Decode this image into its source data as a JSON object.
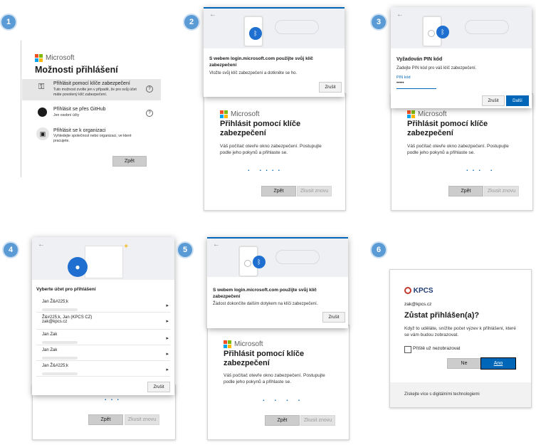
{
  "badges": [
    "1",
    "2",
    "3",
    "4",
    "5",
    "6"
  ],
  "brand": "Microsoft",
  "colors": {
    "accent": "#0067b8",
    "badge": "#5b9bd5"
  },
  "p1": {
    "title": "Možnosti přihlášení",
    "options": [
      {
        "title": "Přihlásit pomocí klíče zabezpečení",
        "desc": "Tuto možnost zvolte jen v případě, že pro svůj účet máte povolený klíč zabezpečení.",
        "icon": "security-key-icon",
        "help": "?"
      },
      {
        "title": "Přihlásit se přes GitHub",
        "desc": "Jen osobní účty",
        "icon": "github-icon",
        "help": "?"
      },
      {
        "title": "Přihlásit se k organizaci",
        "desc": "Vyhledejte společnost nebo organizaci, ve které pracujete.",
        "icon": "organization-badge-icon"
      }
    ],
    "back": "Zpět"
  },
  "p2": {
    "dialog_title": "S webem login.microsoft.com použijte svůj klíč zabezpečení",
    "dialog_text": "Vložte svůj klíč zabezpečení a dotkněte se ho.",
    "cancel": "Zrušit",
    "card_title": "Přihlásit pomocí klíče zabezpečení",
    "card_text": "Váš počítač otevře okno zabezpečení. Postupujte podle jeho pokynů a přihlaste se.",
    "back": "Zpět",
    "retry": "Zkusit znovu"
  },
  "p3": {
    "dialog_title": "Vyžadován PIN kód",
    "dialog_text": "Zadejte PIN kód pro váš klíč zabezpečení.",
    "pin_label": "PIN kód",
    "pin_value": "•••••",
    "cancel": "Zrušit",
    "next": "Další",
    "card_title": "Přihlásit pomocí klíče zabezpečení",
    "card_text": "Váš počítač otevře okno zabezpečení. Postupujte podle jeho pokynů a přihlaste se.",
    "back": "Zpět",
    "retry": "Zkusit znovu"
  },
  "p4": {
    "heading": "Vyberte účet pro přihlášení",
    "accounts": [
      {
        "name": "Jan Ž&#225;k",
        "sub": ""
      },
      {
        "name": "Ž&#225;k, Jan (KPCS CZ)",
        "sub": "zak@kpcs.cz"
      },
      {
        "name": "Jan Zak",
        "sub": ""
      },
      {
        "name": "Jan Zak",
        "sub": ""
      },
      {
        "name": "Jan Ž&#225;k",
        "sub": ""
      }
    ],
    "cancel": "Zrušit",
    "back": "Zpět",
    "retry": "Zkusit znovu"
  },
  "p5": {
    "dialog_title": "S webem login.microsoft.com použijte svůj klíč zabezpečení",
    "dialog_text": "Žádost dokončíte dalším dotykem na klíči zabezpečení.",
    "cancel": "Zrušit",
    "card_title": "Přihlásit pomocí klíče zabezpečení",
    "card_text": "Váš počítač otevře okno zabezpečení. Postupujte podle jeho pokynů a přihlaste se.",
    "back": "Zpět",
    "retry": "Zkusit znovu"
  },
  "p6": {
    "logo": "KPCS",
    "email": "zak@kpcs.cz",
    "title": "Zůstat přihlášen(a)?",
    "text": "Když to uděláte, snížíte počet výzev k přihlášení, které se vám budou zobrazovat.",
    "checkbox": "Příště už nezobrazovat",
    "no": "Ne",
    "yes": "Ano",
    "footer": "Získejte více s digitálními technologiemi"
  }
}
